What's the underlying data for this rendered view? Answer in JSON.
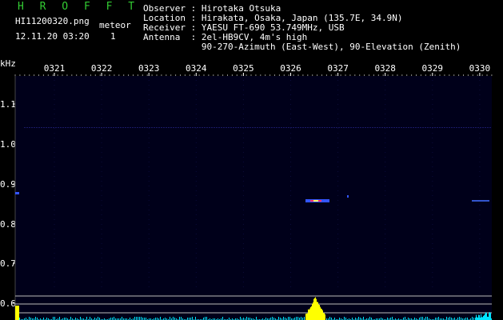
{
  "header": {
    "program_title": "H R O F F T",
    "filename": "HI11200320.png",
    "meteor_label": "meteor",
    "timestamp": "12.11.20 03:20",
    "meteor_count": "1",
    "observer": "Observer : Hirotaka Otsuka",
    "location": "Location : Hirakata, Osaka, Japan (135.7E, 34.9N)",
    "receiver": "Receiver : YAESU FT-690 53.749MHz, USB",
    "antenna": "Antenna  : 2el-HB9CV, 4m's high",
    "antenna_detail": "           90-270-Azimuth (East-West), 90-Elevation (Zenith)"
  },
  "axes": {
    "y_unit": "kHz",
    "y_ticks": [
      "1.1",
      "1.0",
      "0.9",
      "0.8",
      "0.7",
      "0.6"
    ],
    "x_ticks": [
      "0321",
      "0322",
      "0323",
      "0324",
      "0325",
      "0326",
      "0327",
      "0328",
      "0329",
      "0330"
    ]
  },
  "colors": {
    "background": "#000000",
    "plot_background": "#00001a",
    "text": "#ffffff",
    "title": "#33cc33",
    "signal_yellow": "#ffff00",
    "signal_cyan": "#00e5ff"
  }
}
